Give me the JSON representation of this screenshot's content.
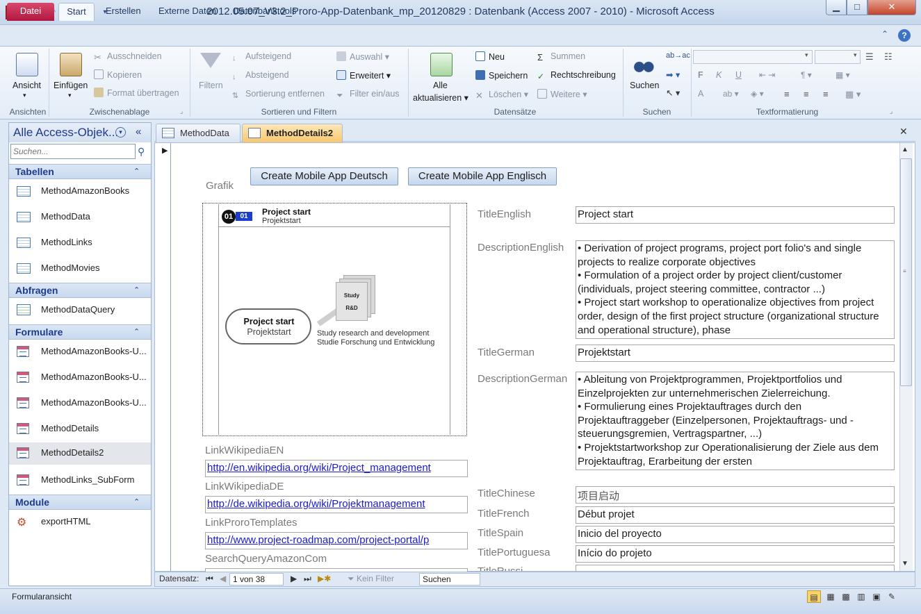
{
  "window": {
    "app_icon_letter": "A",
    "title": "2012.05.07_V3.2_Proro-App-Datenbank_mp_20120829 : Datenbank (Access 2007 - 2010)  -  Microsoft Access",
    "minimize_glyph": "▁",
    "maximize_glyph": "□",
    "close_glyph": "✕"
  },
  "quick_access": [
    "save-icon",
    "undo-icon",
    "redo-icon",
    "customize-icon"
  ],
  "ribbon": {
    "tabs": [
      "Datei",
      "Start",
      "Erstellen",
      "Externe Daten",
      "Datenbanktools"
    ],
    "active_tab": "Start",
    "help_glyph": "?",
    "collapse_glyph": "⌃",
    "groups": {
      "ansichten": {
        "label": "Ansichten",
        "ansicht": "Ansicht"
      },
      "zwischenablage": {
        "label": "Zwischenablage",
        "einfuegen": "Einfügen",
        "ausschneiden": "Ausschneiden",
        "kopieren": "Kopieren",
        "format": "Format übertragen"
      },
      "sortieren": {
        "label": "Sortieren und Filtern",
        "filtern": "Filtern",
        "aufsteigend": "Aufsteigend",
        "absteigend": "Absteigend",
        "sortierung": "Sortierung entfernen",
        "auswahl": "Auswahl",
        "erweitert": "Erweitert",
        "filter": "Filter ein/aus"
      },
      "datensaetze": {
        "label": "Datensätze",
        "alle": "Alle",
        "aktualisieren": "aktualisieren",
        "neu": "Neu",
        "speichern": "Speichern",
        "loeschen": "Löschen",
        "summen": "Summen",
        "rechtschreibung": "Rechtschreibung",
        "weitere": "Weitere"
      },
      "suchen": {
        "label": "Suchen",
        "suchen": "Suchen"
      },
      "text": {
        "label": "Textformatierung",
        "bold": "F",
        "italic": "K",
        "underline": "U",
        "fontcolor": "A"
      }
    }
  },
  "nav": {
    "title": "Alle Access-Objek...",
    "search_placeholder": "Suchen...",
    "sections": {
      "tabellen": {
        "label": "Tabellen",
        "items": [
          "MethodAmazonBooks",
          "MethodData",
          "MethodLinks",
          "MethodMovies"
        ]
      },
      "abfragen": {
        "label": "Abfragen",
        "items": [
          "MethodDataQuery"
        ]
      },
      "formulare": {
        "label": "Formulare",
        "items": [
          "MethodAmazonBooks-U...",
          "MethodAmazonBooks-U...",
          "MethodAmazonBooks-U...",
          "MethodDetails",
          "MethodDetails2",
          "MethodLinks_SubForm"
        ]
      },
      "module": {
        "label": "Module",
        "items": [
          "exportHTML"
        ]
      }
    },
    "selected_item": "MethodDetails2"
  },
  "doc_tabs": [
    "MethodData",
    "MethodDetails2"
  ],
  "active_doc_tab": "MethodDetails2",
  "form": {
    "grafik_label": "Grafik",
    "btn_deutsch": "Create Mobile App Deutsch",
    "btn_englisch": "Create Mobile App Englisch",
    "graphic": {
      "num_circle": "01",
      "num_box": "01",
      "title": "Project start",
      "subtitle": "Projektstart",
      "cloud_en": "Project start",
      "cloud_de": "Projektstart",
      "doc_line1": "Study",
      "doc_line2": "R&D",
      "caption_en": "Study research and development",
      "caption_de": "Studie Forschung und Entwicklung"
    },
    "links": [
      {
        "label": "LinkWikipediaEN",
        "value": "http://en.wikipedia.org/wiki/Project_management"
      },
      {
        "label": "LinkWikipediaDE",
        "value": "http://de.wikipedia.org/wiki/Projektmanagement"
      },
      {
        "label": "LinkProroTemplates",
        "value": "http://www.project-roadmap.com/project-portal/p"
      },
      {
        "label": "SearchQueryAmazonCom",
        "value": ""
      }
    ],
    "title_english": {
      "label": "TitleEnglish",
      "value": "Project start"
    },
    "description_english": {
      "label": "DescriptionEnglish",
      "lines": [
        "• Derivation of project programs, project port folio's and single projects to realize corporate objectives",
        "• Formulation of a project order by project client/customer (individuals, project steering committee, contractor ...)",
        "• Project start workshop to operationalize objectives from project order, design of the first project structure (organizational structure and operational structure), phase"
      ]
    },
    "title_german": {
      "label": "TitleGerman",
      "value": "Projektstart"
    },
    "description_german": {
      "label": "DescriptionGerman",
      "lines": [
        "• Ableitung von Projektprogrammen, Projektportfolios und Einzelprojekten zur unternehmerischen Zielerreichung.",
        "• Formulierung eines Projektauftrages durch den Projektauftraggeber (Einzelpersonen, Projektauftrags- und -steuerungsgremien, Vertragspartner, ...)",
        "• Projektstartworkshop zur Operationalisierung der Ziele aus dem Projektauftrag, Erarbeitung der ersten"
      ]
    },
    "title_chinese": {
      "label": "TitleChinese",
      "value": "项目启动"
    },
    "title_french": {
      "label": "TitleFrench",
      "value": "Début projet"
    },
    "title_spain": {
      "label": "TitleSpain",
      "value": "Inicio del proyecto"
    },
    "title_portuguesa": {
      "label": "TitlePortuguesa",
      "value": "Início do projeto"
    },
    "title_next": {
      "label": "TitleRussi...",
      "value": ""
    }
  },
  "record_nav": {
    "label": "Datensatz:",
    "position": "1 von 38",
    "filter": "Kein Filter",
    "search": "Suchen"
  },
  "status": {
    "text": "Formularansicht"
  }
}
